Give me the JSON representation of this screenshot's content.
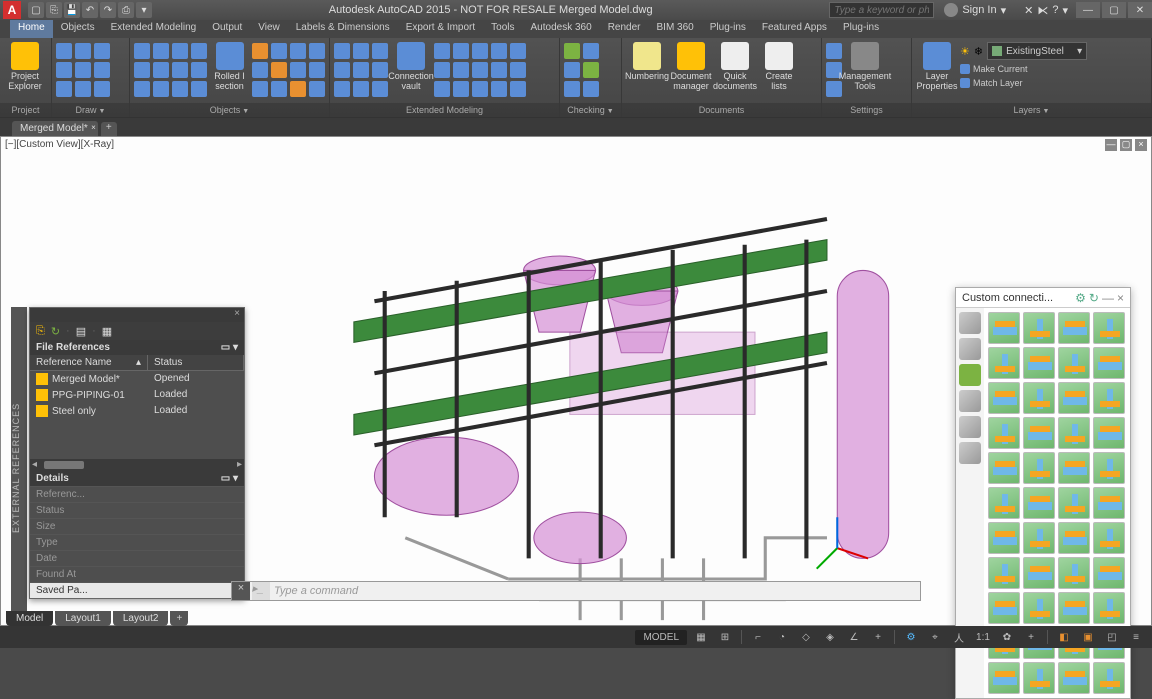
{
  "titlebar": {
    "app_icon_letter": "A",
    "title": "Autodesk AutoCAD 2015 - NOT FOR RESALE    Merged Model.dwg",
    "search_placeholder": "Type a keyword or phrase",
    "signin": "Sign In"
  },
  "ribbon_tabs": [
    "Home",
    "Objects",
    "Extended Modeling",
    "Output",
    "View",
    "Labels & Dimensions",
    "Export & Import",
    "Tools",
    "Autodesk 360",
    "Render",
    "BIM 360",
    "Plug-ins",
    "Featured Apps",
    "Plug-ins"
  ],
  "ribbon_active_tab": "Home",
  "ribbon_panels": {
    "project": {
      "label": "Project",
      "big": "Project Explorer"
    },
    "draw": {
      "label": "Draw"
    },
    "objects": {
      "label": "Objects",
      "big": "Rolled I section"
    },
    "ext": {
      "label": "Extended Modeling",
      "big": "Connection vault"
    },
    "checking": {
      "label": "Checking"
    },
    "documents": {
      "label": "Documents",
      "items": [
        "Numbering",
        "Document manager",
        "Quick documents",
        "Create lists"
      ]
    },
    "settings": {
      "label": "Settings",
      "big": "Management Tools"
    },
    "layers": {
      "label": "Layers",
      "big": "Layer Properties",
      "dropdown": "ExistingSteel",
      "actions": [
        "Make Current",
        "Match Layer"
      ]
    }
  },
  "doc_tab": "Merged Model*",
  "viewport_label": "[−][Custom View][X-Ray]",
  "xref": {
    "strip_title": "EXTERNAL REFERENCES",
    "header": "File References",
    "cols": [
      "Reference Name",
      "Status"
    ],
    "rows": [
      {
        "name": "Merged Model*",
        "status": "Opened"
      },
      {
        "name": "PPG-PIPING-01",
        "status": "Loaded"
      },
      {
        "name": "Steel only",
        "status": "Loaded"
      }
    ],
    "details_header": "Details",
    "details": [
      "Referenc...",
      "Status",
      "Size",
      "Type",
      "Date",
      "Found At",
      "Saved Pa..."
    ]
  },
  "conn_panel": {
    "title": "Custom connecti..."
  },
  "cmdline_placeholder": "Type a command",
  "bottom_tabs": [
    "Model",
    "Layout1",
    "Layout2"
  ],
  "status_model": "MODEL",
  "status_scale": "1:1"
}
